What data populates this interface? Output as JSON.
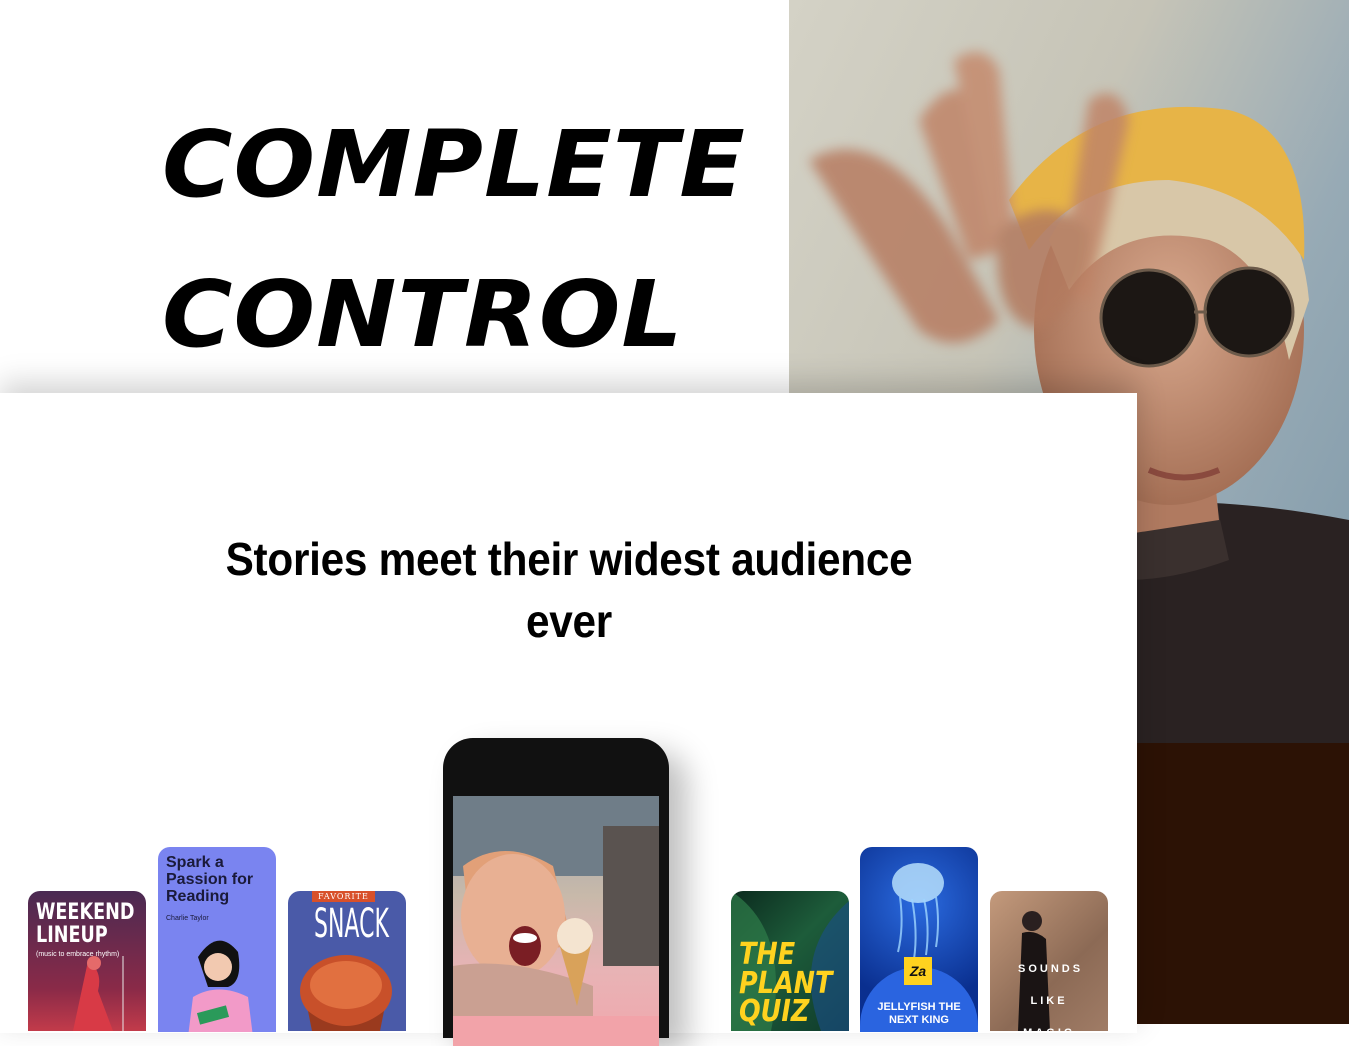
{
  "hero": {
    "line1": "COMPLETE",
    "line2": "CONTROL"
  },
  "section": {
    "headline": "Stories meet their widest audience ever"
  },
  "stories": [
    {
      "title": "WEEKEND LINEUP",
      "subtitle": "(music to embrace rhythm)"
    },
    {
      "title": "Spark a Passion for Reading",
      "subtitle": "Charlie Taylor"
    },
    {
      "badge": "FAVORITE",
      "title": "SNACK"
    },
    {
      "title": "THE PLANT QUIZ"
    },
    {
      "logo": "Za",
      "title": "JELLYFISH THE NEXT KING"
    },
    {
      "title": "SOUNDS LIKE MAGIC"
    }
  ],
  "phone": {
    "close_glyph": "×"
  },
  "colors": {
    "story_weekend": "#7a2a45",
    "story_reading": "#7a84f0",
    "story_snack": "#4a5aa8",
    "story_plant": "#0f3a2b",
    "story_jelly": "#0a2f8f",
    "story_sounds": "#9a7c66",
    "plant_text": "#ffd21f",
    "jelly_badge": "#ffd21f",
    "photo_bottom": "#2c1205"
  }
}
